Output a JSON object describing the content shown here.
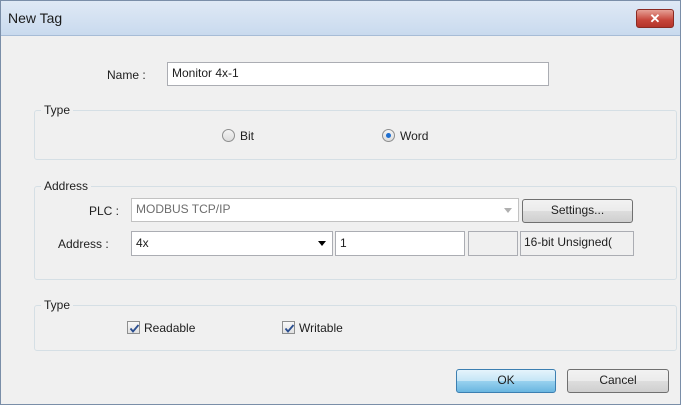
{
  "window": {
    "title": "New Tag",
    "close_glyph": "✕"
  },
  "name": {
    "label": "Name :",
    "value": "Monitor 4x-1"
  },
  "type_group": {
    "title": "Type",
    "options": [
      {
        "label": "Bit",
        "selected": false
      },
      {
        "label": "Word",
        "selected": true
      }
    ]
  },
  "address_group": {
    "title": "Address",
    "plc_label": "PLC :",
    "plc_value": "MODBUS TCP/IP",
    "settings_label": "Settings...",
    "address_label": "Address :",
    "address_type": "4x",
    "address_value": "1",
    "extra_value": "",
    "data_format": "16-bit Unsigned("
  },
  "access_group": {
    "title": "Type",
    "readable_label": "Readable",
    "readable_checked": true,
    "writable_label": "Writable",
    "writable_checked": true
  },
  "buttons": {
    "ok": "OK",
    "cancel": "Cancel"
  },
  "colors": {
    "accent": "#1e6fd0",
    "close": "#c6453a"
  }
}
